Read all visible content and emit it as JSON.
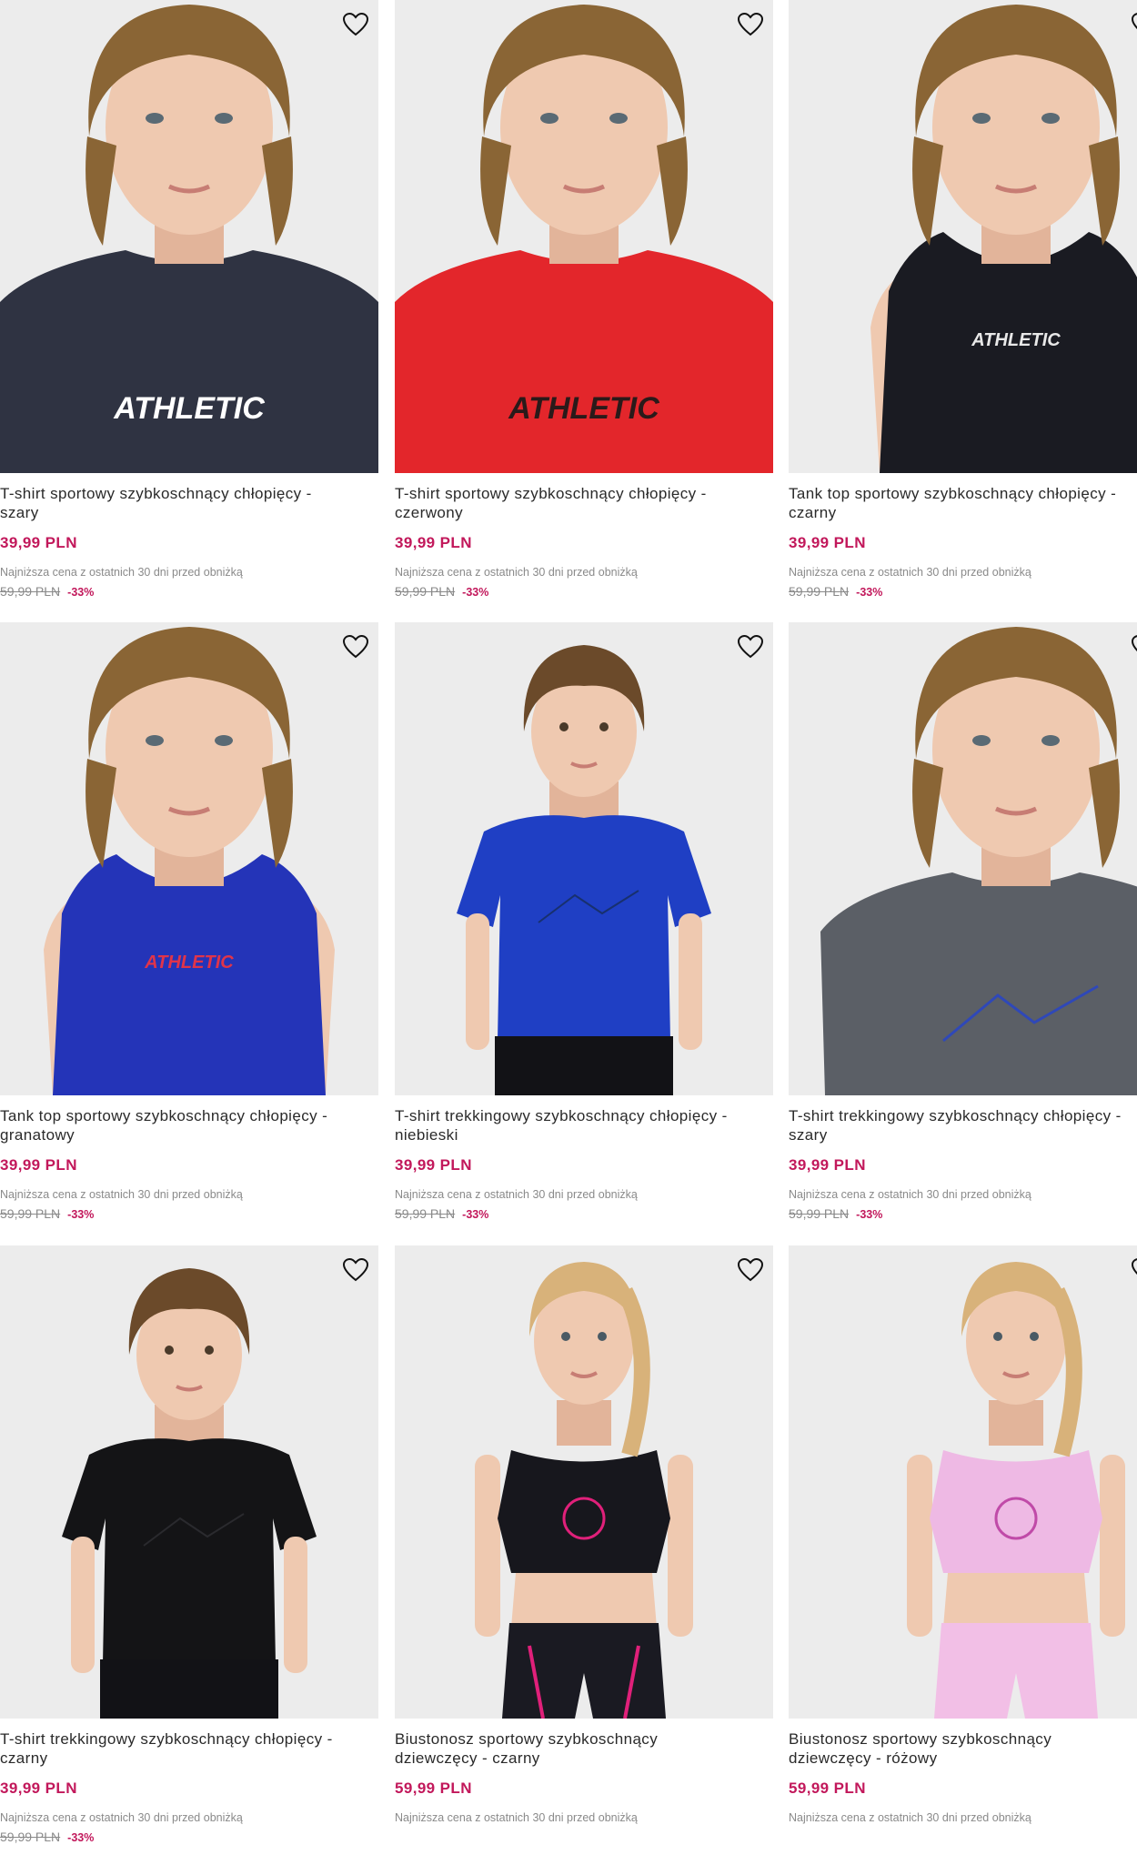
{
  "colors": {
    "price": "#c2185b",
    "discount": "#c2185b",
    "photo_background": "#ececec"
  },
  "products": [
    {
      "name": "T-shirt sportowy szybkoschnący chłopięcy -\nszary",
      "price": "39,99 PLN",
      "lowest_label": "Najniższa cena z ostatnich 30 dni przed obniżką",
      "old_price": "59,99 PLN",
      "discount": "-33%",
      "shirt_color": "#2f3342",
      "graphic_text": "ATHLETIC",
      "graphic_color": "#ffffff",
      "garment": "tshirt",
      "hair": "#8a6535",
      "icon": "heart-outline-icon"
    },
    {
      "name": "T-shirt sportowy szybkoschnący chłopięcy -\nczerwony",
      "price": "39,99 PLN",
      "lowest_label": "Najniższa cena z ostatnich 30 dni przed obniżką",
      "old_price": "59,99 PLN",
      "discount": "-33%",
      "shirt_color": "#e3262b",
      "graphic_text": "ATHLETIC",
      "graphic_color": "#2a1a1a",
      "garment": "tshirt",
      "hair": "#8a6535",
      "icon": "heart-outline-icon"
    },
    {
      "name": "Tank top sportowy szybkoschnący chłopięcy -\nczarny",
      "price": "39,99 PLN",
      "lowest_label": "Najniższa cena z ostatnich 30 dni przed obniżką",
      "old_price": "59,99 PLN",
      "discount": "-33%",
      "shirt_color": "#1a1b22",
      "graphic_text": "ATHLETIC",
      "graphic_color": "#e8e8e8",
      "garment": "tank",
      "hair": "#8a6535",
      "icon": "heart-outline-icon"
    },
    {
      "name": "Tank top sportowy szybkoschnący chłopięcy -\ngranatowy",
      "price": "39,99 PLN",
      "lowest_label": "Najniższa cena z ostatnich 30 dni przed obniżką",
      "old_price": "59,99 PLN",
      "discount": "-33%",
      "shirt_color": "#2434b8",
      "graphic_text": "ATHLETIC",
      "graphic_color": "#e0344a",
      "garment": "tank",
      "hair": "#8a6535",
      "icon": "heart-outline-icon"
    },
    {
      "name": "T-shirt trekkingowy szybkoschnący chłopięcy -\nniebieski",
      "price": "39,99 PLN",
      "lowest_label": "Najniższa cena z ostatnich 30 dni przed obniżką",
      "old_price": "59,99 PLN",
      "discount": "-33%",
      "shirt_color": "#1f3fc4",
      "graphic_text": "",
      "graphic_color": "#18306e",
      "garment": "tshirt-full",
      "hair": "#6b4a2a",
      "icon": "heart-outline-icon"
    },
    {
      "name": "T-shirt trekkingowy szybkoschnący chłopięcy -\nszary",
      "price": "39,99 PLN",
      "lowest_label": "Najniższa cena z ostatnich 30 dni przed obniżką",
      "old_price": "59,99 PLN",
      "discount": "-33%",
      "shirt_color": "#5b5f66",
      "graphic_text": "",
      "graphic_color": "#2f48b8",
      "garment": "tshirt",
      "hair": "#8a6535",
      "icon": "heart-outline-icon"
    },
    {
      "name": "T-shirt trekkingowy szybkoschnący chłopięcy -\nczarny",
      "price": "39,99 PLN",
      "lowest_label": "Najniższa cena z ostatnich 30 dni przed obniżką",
      "old_price": "59,99 PLN",
      "discount": "-33%",
      "shirt_color": "#141416",
      "graphic_text": "",
      "graphic_color": "#2a2a2e",
      "garment": "tshirt-full",
      "hair": "#6b4a2a",
      "icon": "heart-outline-icon"
    },
    {
      "name": "Biustonosz sportowy szybkoschnący\ndziewczęcy - czarny",
      "price": "59,99 PLN",
      "lowest_label": "Najniższa cena z ostatnich 30 dni przed obniżką",
      "old_price": "",
      "discount": "",
      "shirt_color": "#17171d",
      "graphic_text": "",
      "graphic_color": "#e0207a",
      "garment": "crop",
      "hair": "#d8b27a",
      "icon": "heart-outline-icon"
    },
    {
      "name": "Biustonosz sportowy szybkoschnący\ndziewczęcy - różowy",
      "price": "59,99 PLN",
      "lowest_label": "Najniższa cena z ostatnich 30 dni przed obniżką",
      "old_price": "",
      "discount": "",
      "shirt_color": "#eeb9e4",
      "graphic_text": "",
      "graphic_color": "#c04aa8",
      "garment": "crop",
      "hair": "#d8b27a",
      "icon": "heart-outline-icon"
    }
  ]
}
